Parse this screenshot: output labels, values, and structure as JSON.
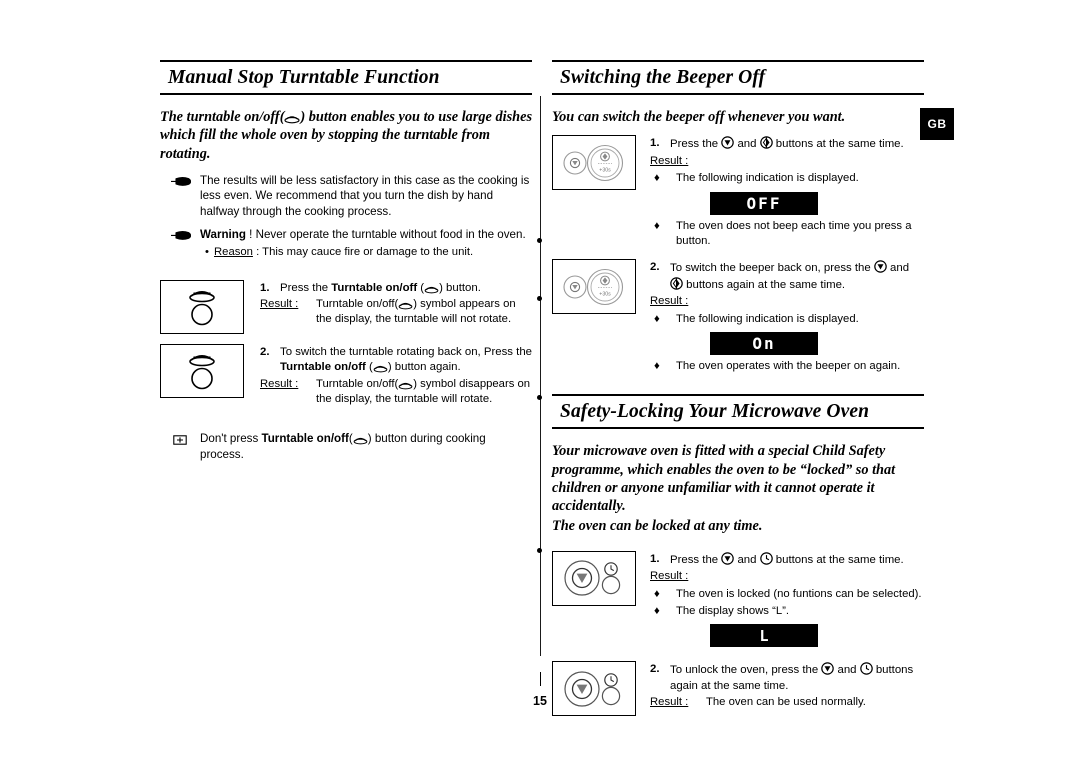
{
  "page": {
    "number": "15",
    "region_tab": "GB"
  },
  "left_column": {
    "heading": "Manual Stop Turntable Function",
    "intro": "The turntable on/off( ) button enables you to use large dishes which fill the whole oven by stopping the turntable from rotating.",
    "intro_part1": "The turntable on/off(",
    "intro_part2": ") button enables you to use large dishes which fill the whole oven by stopping the turntable from rotating.",
    "notes": [
      {
        "glyph": "pointing-hand",
        "text": "The results will be less satisfactory in this case as the cooking is less even. We recommend that you turn the dish by hand halfway through the cooking process."
      },
      {
        "glyph": "pointing-hand",
        "bold_lead": "Warning",
        "text": " ! Never operate the turntable without food in the oven.",
        "sub_bullet": {
          "mark": "•",
          "label": "Reason",
          "text": " : This may cauce fire or damage to the unit."
        }
      }
    ],
    "steps": [
      {
        "num": "1.",
        "icon": "turntable-on-off-icon",
        "text_before": "Press the ",
        "bold": "Turntable on/off",
        "text_after": " ( ) button.",
        "result_label": "Result :",
        "result_text": "Turntable on/off( ) symbol appears on the display, the turntable will not rotate."
      },
      {
        "num": "2.",
        "icon": "turntable-on-off-icon",
        "text_before": "To switch the turntable rotating back on, Press the ",
        "bold": "Turntable on/off",
        "text_after": " ( ) button again.",
        "result_label": "Result :",
        "result_text": "Turntable on/off( ) symbol disappears on the display, the turntable will rotate."
      }
    ],
    "footer_note": {
      "glyph": "small-square-marker",
      "text_before": "Don't press ",
      "bold": "Turntable on/off",
      "text_after": "( ) button during cooking process."
    }
  },
  "right_column": {
    "beeper": {
      "heading": "Switching the Beeper Off",
      "intro": "You can switch the beeper off whenever you want.",
      "steps": [
        {
          "num": "1.",
          "icon": "control-panel-stop-start-icon",
          "text_before": "Press the ",
          "icon1": "stop-button-icon",
          "text_mid": " and ",
          "icon2": "start-30s-button-icon",
          "text_after": " buttons at the same time.",
          "result_label": "Result :",
          "diamonds": [
            {
              "mark": "♦",
              "text": "The following indication is displayed."
            }
          ],
          "lcd": "OFF",
          "diamonds_after": [
            {
              "mark": "♦",
              "text": "The oven does not beep each time you press a button."
            }
          ]
        },
        {
          "num": "2.",
          "icon": "control-panel-stop-start-icon",
          "text_before": "To switch the beeper back on, press the ",
          "icon1": "stop-button-icon",
          "text_mid": " and ",
          "icon2": "start-30s-button-icon",
          "text_after": " buttons again at the same time.",
          "result_label": "Result :",
          "diamonds": [
            {
              "mark": "♦",
              "text": "The following indication is displayed."
            }
          ],
          "lcd": "On",
          "diamonds_after": [
            {
              "mark": "♦",
              "text": "The oven operates with the beeper on again."
            }
          ]
        }
      ]
    },
    "safety_lock": {
      "heading": "Safety-Locking Your Microwave Oven",
      "intro_line1": "Your microwave oven is fitted with a special Child Safety programme, which enables the oven to be “locked” so that children or anyone unfamiliar with it cannot operate it accidentally.",
      "intro_line2": "The oven can be locked at any time.",
      "steps": [
        {
          "num": "1.",
          "icon": "control-panel-stop-clock-icon",
          "text_before": "Press the ",
          "icon1": "stop-button-icon",
          "text_mid": " and ",
          "icon2": "clock-button-icon",
          "text_after": " buttons at the same time.",
          "result_label": "Result :",
          "diamonds": [
            {
              "mark": "♦",
              "text": "The oven is locked (no funtions can be selected)."
            },
            {
              "mark": "♦",
              "text": "The display shows “L”."
            }
          ],
          "lcd": "L"
        },
        {
          "num": "2.",
          "icon": "control-panel-stop-clock-icon",
          "text_before": "To unlock the oven, press the ",
          "icon1": "stop-button-icon",
          "text_mid": " and ",
          "icon2": "clock-button-icon",
          "text_after": " buttons again at the same time.",
          "result_label": "Result :",
          "result_text": "The oven can be used normally."
        }
      ]
    }
  }
}
